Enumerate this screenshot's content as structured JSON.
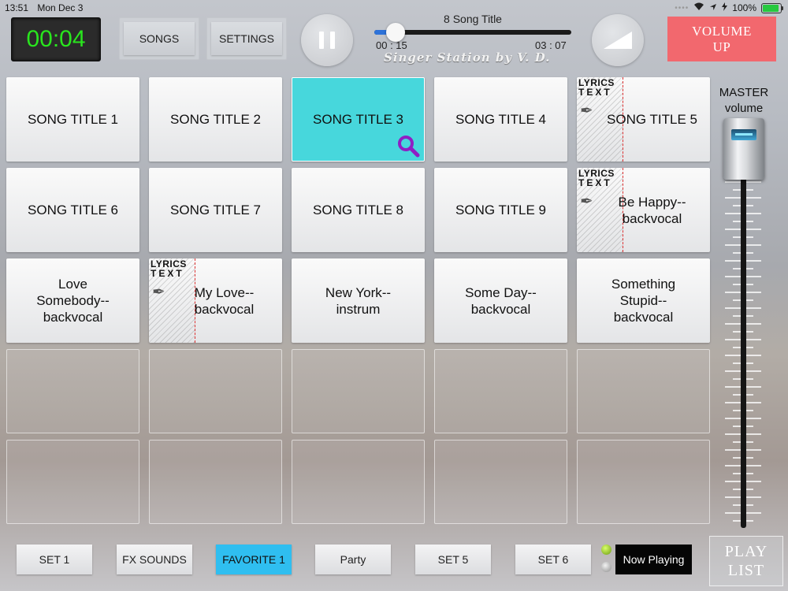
{
  "status": {
    "time": "13:51",
    "date": "Mon Dec 3",
    "battery": "100%",
    "battery_level": 1.0
  },
  "header": {
    "timer": "00:04",
    "songs_label": "SONGS",
    "settings_label": "SETTINGS",
    "song_title": "8 Song Title",
    "elapsed": "00 : 15",
    "duration": "03 : 07",
    "progress": 0.08,
    "brand": "Singer Station by V. D.",
    "volume_up_line1": "VOLUME",
    "volume_up_line2": "UP"
  },
  "pads": [
    {
      "title": "SONG TITLE 1"
    },
    {
      "title": "SONG TITLE 2"
    },
    {
      "title": "SONG TITLE 3",
      "active": true,
      "search": true
    },
    {
      "title": "SONG TITLE 4"
    },
    {
      "title": "SONG TITLE 5",
      "lyrics": true
    },
    {
      "title": "SONG TITLE 6"
    },
    {
      "title": "SONG TITLE 7"
    },
    {
      "title": "SONG TITLE 8"
    },
    {
      "title": "SONG TITLE 9"
    },
    {
      "title": "Be Happy--\nbackvocal",
      "lyrics": true
    },
    {
      "title": "Love\nSomebody--\nbackvocal"
    },
    {
      "title": "My Love--\nbackvocal",
      "lyrics": true
    },
    {
      "title": "New York--\ninstrum"
    },
    {
      "title": "Some Day--\nbackvocal"
    },
    {
      "title": "Something\nStupid--\nbackvocal"
    },
    {
      "title": ""
    },
    {
      "title": ""
    },
    {
      "title": ""
    },
    {
      "title": ""
    },
    {
      "title": ""
    },
    {
      "title": ""
    },
    {
      "title": ""
    },
    {
      "title": ""
    },
    {
      "title": ""
    },
    {
      "title": ""
    }
  ],
  "lyrics_badge": {
    "line1": "LYRICS",
    "line2": "TEXT"
  },
  "master": {
    "line1": "MASTER",
    "line2": "volume",
    "level": 1.0
  },
  "footer": {
    "sets": [
      {
        "label": "SET 1"
      },
      {
        "label": "FX SOUNDS"
      },
      {
        "label": "FAVORITE 1",
        "active": true
      },
      {
        "label": "Party"
      },
      {
        "label": "SET 5"
      },
      {
        "label": "SET 6"
      }
    ],
    "now_playing": "Now Playing",
    "playlist_line1": "PLAY",
    "playlist_line2": "LIST"
  },
  "colors": {
    "active_pad": "#47d7dc",
    "active_set": "#2fbef0",
    "volume_up": "#f2686e",
    "timer_text": "#29e51e",
    "search_icon": "#8f1fc4"
  }
}
